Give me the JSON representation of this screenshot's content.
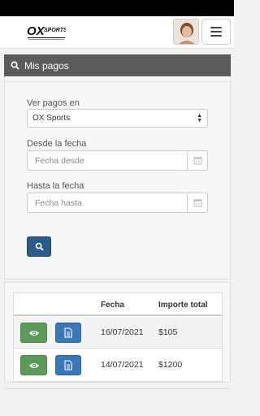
{
  "header": {
    "logo_icon": "ox-sports-logo",
    "avatar_icon": "user-avatar",
    "menu_icon": "hamburger-menu-icon"
  },
  "panel": {
    "title": "Mis pagos",
    "title_icon": "search-icon"
  },
  "filters": {
    "ver_pagos_label": "Ver pagos en",
    "ver_pagos_value": "OX Sports",
    "desde_label": "Desde la fecha",
    "desde_placeholder": "Fecha desde",
    "hasta_label": "Hasta la fecha",
    "hasta_placeholder": "Fecha hasta",
    "search_icon": "search-icon",
    "calendar_icon": "calendar-icon"
  },
  "table": {
    "columns": [
      "",
      "Fecha",
      "Importe total"
    ],
    "rows": [
      {
        "fecha": "16/07/2021",
        "importe": "$105",
        "view_icon": "eye-icon",
        "doc_icon": "document-icon"
      },
      {
        "fecha": "14/07/2021",
        "importe": "$1200",
        "view_icon": "eye-icon",
        "doc_icon": "document-icon"
      }
    ]
  },
  "colors": {
    "panel_header": "#5b5b5b",
    "search_button": "#2a5c8a",
    "view_button": "#5b9a5b",
    "doc_button": "#3a78b8"
  }
}
